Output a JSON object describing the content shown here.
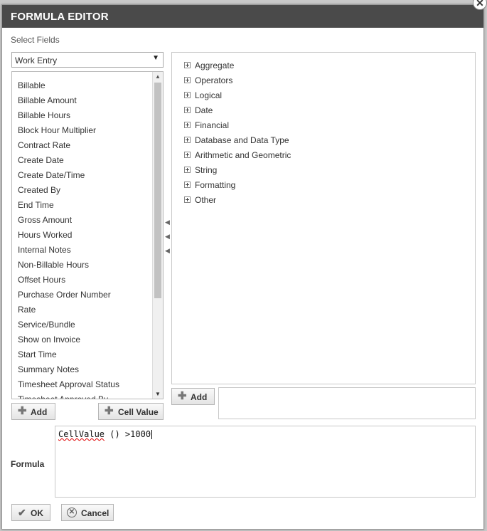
{
  "dialog": {
    "title": "FORMULA EDITOR",
    "close_glyph": "✕"
  },
  "fields": {
    "section_label": "Select Fields",
    "entity_select": {
      "value": "Work Entry",
      "arrow": "▼"
    },
    "items": [
      "Billable",
      "Billable Amount",
      "Billable Hours",
      "Block Hour Multiplier",
      "Contract Rate",
      "Create Date",
      "Create Date/Time",
      "Created By",
      "End Time",
      "Gross Amount",
      "Hours Worked",
      "Internal Notes",
      "Non-Billable Hours",
      "Offset Hours",
      "Purchase Order Number",
      "Rate",
      "Service/Bundle",
      "Show on Invoice",
      "Start Time",
      "Summary Notes",
      "Timesheet Approval Status",
      "Timesheet Approved By"
    ],
    "add_button": "Add",
    "cell_value_button": "Cell Value"
  },
  "functions": {
    "categories": [
      "Aggregate",
      "Operators",
      "Logical",
      "Date",
      "Financial",
      "Database and Data Type",
      "Arithmetic and Geometric",
      "String",
      "Formatting",
      "Other"
    ],
    "add_button": "Add"
  },
  "formula": {
    "label": "Formula",
    "function_name": "CellValue",
    "rest": " () >1000"
  },
  "footer": {
    "ok_button": "OK",
    "cancel_button": "Cancel"
  },
  "icons": {
    "plus": "plus-icon",
    "check": "check-icon",
    "cancel": "cancel-icon",
    "close": "close-icon",
    "expand": "expand-icon"
  }
}
